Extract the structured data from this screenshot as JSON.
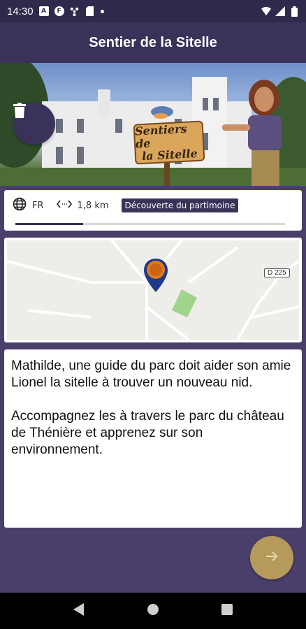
{
  "status_bar": {
    "time": "14:30",
    "icons": [
      "notification-a-icon",
      "notification-f-icon",
      "fan-icon",
      "sd-card-icon",
      "dot-icon",
      "wifi-icon",
      "signal-icon",
      "battery-icon"
    ],
    "notif_a": "A",
    "notif_f": "F"
  },
  "app_bar": {
    "title": "Sentier de la Sitelle"
  },
  "hero": {
    "sign_line1": "Sentiers de",
    "sign_line2": "la Sitelle"
  },
  "info": {
    "language_icon": "globe-icon",
    "language": "FR",
    "distance_icon": "distance-icon",
    "distance": "1,8 km",
    "category": "Découverte du partimoine",
    "progress": 0.25
  },
  "map": {
    "road_label": "D 225"
  },
  "description": {
    "paragraph1": "Mathilde, une guide du parc doit aider son amie Lionel la sitelle à trouver un nouveau nid.",
    "paragraph2": "Accompagnez les à travers le parc du château de Thénière et apprenez sur son environnement."
  },
  "colors": {
    "primary": "#3a3259",
    "background": "#4a3f6b",
    "accent": "#b59a5c",
    "pin": "#1e3a8a"
  }
}
